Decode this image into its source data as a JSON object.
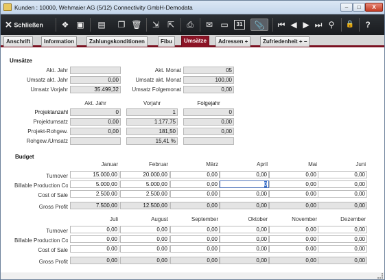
{
  "window": {
    "title": "Kunden : 10000, Wehmaier AG (5/12) Connectivity GmbH-Demodata",
    "min": "–",
    "max": "□",
    "close": "X"
  },
  "toolbar": {
    "close_icon": "✕",
    "close_label": "Schließen",
    "icons": {
      "new": "❖",
      "save": "▣",
      "doc": "▤",
      "copy": "❐",
      "delete": "🗑",
      "import": "⇲",
      "export": "⇱",
      "print": "⎙",
      "mail": "✉",
      "chat": "▭",
      "calendar": "31",
      "attach": "📎",
      "first": "⏮",
      "prev": "◀",
      "next": "▶",
      "last": "⏭",
      "search": "⚲",
      "lock": "🔒",
      "help": "?"
    }
  },
  "tabs": [
    "Anschrift",
    "Information",
    "Zahlungskonditionen",
    "Fibu",
    "Umsätze",
    "Adressen +",
    "Zufriedenheit + −"
  ],
  "umsaetze": {
    "heading": "Umsätze",
    "left": [
      {
        "label": "Akt. Jahr",
        "value": ""
      },
      {
        "label": "Umsatz akt. Jahr",
        "value": "0,00"
      },
      {
        "label": "Umsatz Vorjahr",
        "value": "35.499,32"
      }
    ],
    "right": [
      {
        "label": "Akt. Monat",
        "value": "05"
      },
      {
        "label": "Umsatz akt. Monat",
        "value": "100,00"
      },
      {
        "label": "Umsatz Folgemonat",
        "value": "0,00"
      }
    ]
  },
  "projekt": {
    "headers": [
      "Akt. Jahr",
      "Vorjahr",
      "Folgejahr"
    ],
    "rows": [
      {
        "label": "Projektanzahl",
        "values": [
          "0",
          "1",
          "0"
        ]
      },
      {
        "label": "Projektumsatz",
        "values": [
          "0,00",
          "1.177,75",
          "0,00"
        ]
      },
      {
        "label": "Projekt-Rohgew.",
        "values": [
          "0,00",
          "181,50",
          "0,00"
        ]
      },
      {
        "label": "Rohgew./Umsatz",
        "values": [
          "",
          "15,41 %",
          ""
        ]
      }
    ]
  },
  "budget": {
    "heading": "Budget",
    "row_labels": [
      "Turnover",
      "Billable Production Cost",
      "Cost of Sale",
      "Gross Profit"
    ],
    "half1": {
      "months": [
        "Januar",
        "Februar",
        "März",
        "April",
        "Mai",
        "Juni"
      ],
      "turnover": [
        "15.000,00",
        "20.000,00",
        "0,00",
        "0,00",
        "0,00",
        "0,00"
      ],
      "billable": [
        "5.000,00",
        "5.000,00",
        "0,00",
        "0",
        "0,00",
        "0,00"
      ],
      "cost_of_sale": [
        "2.500,00",
        "2.500,00",
        "0,00",
        "0,00",
        "0,00",
        "0,00"
      ],
      "gross_profit": [
        "7.500,00",
        "12.500,00",
        "0,00",
        "0,00",
        "0,00",
        "0,00"
      ]
    },
    "half2": {
      "months": [
        "Juli",
        "August",
        "September",
        "Oktober",
        "November",
        "Dezember"
      ],
      "turnover": [
        "0,00",
        "0,00",
        "0,00",
        "0,00",
        "0,00",
        "0,00"
      ],
      "billable": [
        "0,00",
        "0,00",
        "0,00",
        "0,00",
        "0,00",
        "0,00"
      ],
      "cost_of_sale": [
        "0,00",
        "0,00",
        "0,00",
        "0,00",
        "0,00",
        "0,00"
      ],
      "gross_profit": [
        "0,00",
        "0,00",
        "0,00",
        "0,00",
        "0,00",
        "0,00"
      ]
    }
  },
  "colors": {
    "accent": "#8b1325",
    "toolbar": "#1f2226",
    "readonly_field": "#e4e4e4"
  }
}
